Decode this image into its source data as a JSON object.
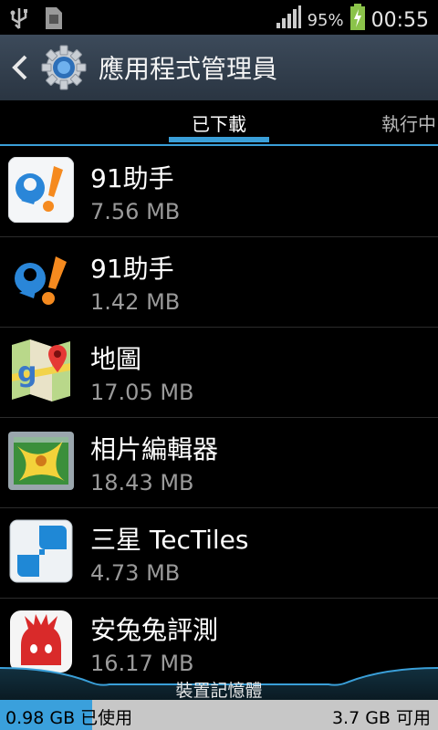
{
  "status_bar": {
    "battery_percent": "95%",
    "time": "00:55",
    "icons": [
      "usb-icon",
      "sd-card-icon",
      "signal-icon",
      "battery-charging-icon"
    ]
  },
  "action_bar": {
    "title": "應用程式管理員",
    "icons": [
      "back-icon",
      "settings-gear-icon"
    ]
  },
  "tabs": [
    {
      "label": "已下載",
      "active": true
    },
    {
      "label": "執行中",
      "active": false
    }
  ],
  "apps": [
    {
      "name": " 91助手",
      "size": "7.56 MB",
      "icon": "91-assistant-icon"
    },
    {
      "name": "91助手",
      "size": "1.42 MB",
      "icon": "91-assistant-icon"
    },
    {
      "name": "地圖",
      "size": "17.05 MB",
      "icon": "google-maps-icon"
    },
    {
      "name": "相片編輯器",
      "size": "18.43 MB",
      "icon": "photo-editor-icon"
    },
    {
      "name": "三星 TecTiles",
      "size": "4.73 MB",
      "icon": "tectiles-icon"
    },
    {
      "name": "安兔兔評測",
      "size": "16.17 MB",
      "icon": "antutu-icon"
    }
  ],
  "storage": {
    "label": "裝置記憶體",
    "used": "0.98 GB 已使用",
    "free": "3.7 GB 可用",
    "used_fraction": 0.21
  },
  "colors": {
    "accent": "#3a9fd8",
    "action_bar": "#34404e"
  }
}
